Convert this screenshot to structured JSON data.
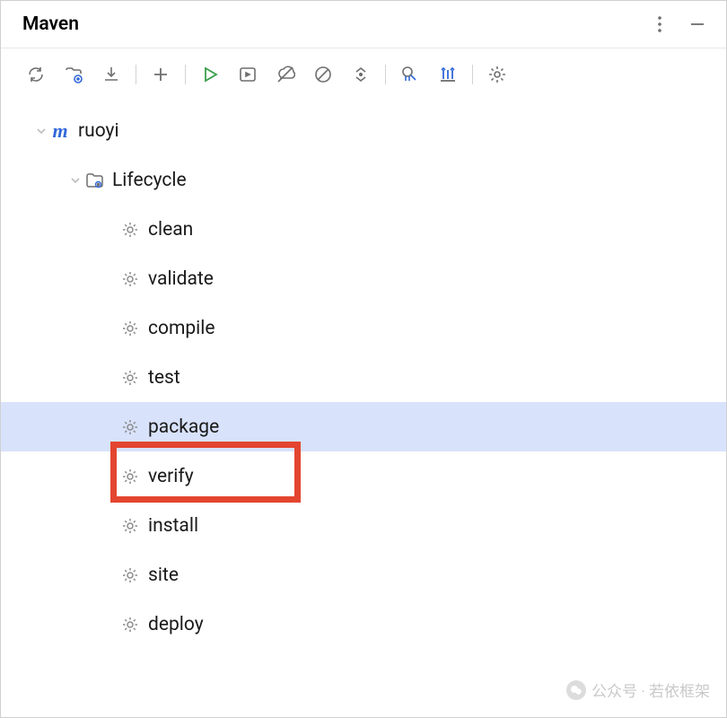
{
  "panel": {
    "title": "Maven"
  },
  "tree": {
    "root": {
      "label": "ruoyi"
    },
    "lifecycle": {
      "label": "Lifecycle"
    },
    "goals": {
      "clean": "clean",
      "validate": "validate",
      "compile": "compile",
      "test": "test",
      "package": "package",
      "verify": "verify",
      "install": "install",
      "site": "site",
      "deploy": "deploy"
    },
    "selected": "package"
  },
  "watermark": {
    "text": "公众号 · 若依框架"
  }
}
